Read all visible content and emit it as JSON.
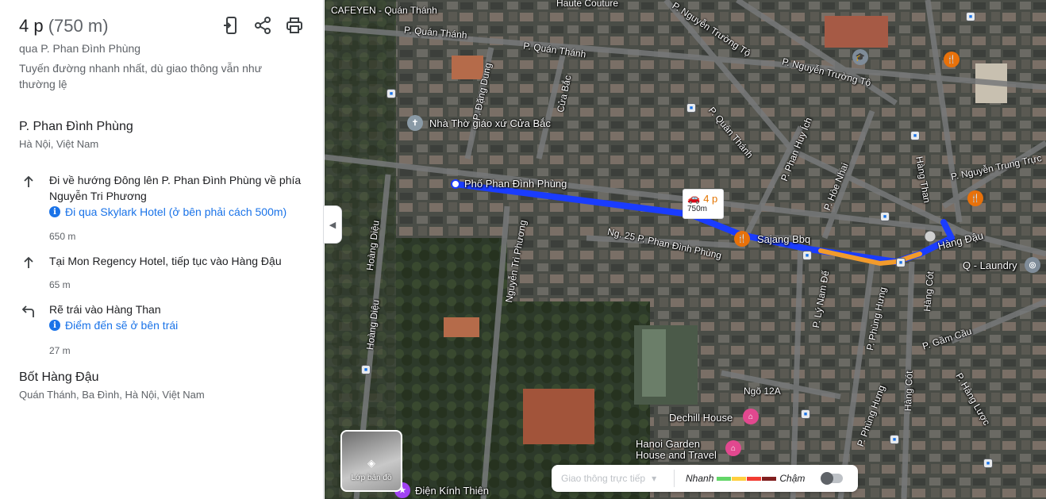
{
  "route": {
    "time": "4 p",
    "distance": "(750 m)",
    "via": "qua P. Phan Đình Phùng",
    "note": "Tuyến đường nhanh nhất, dù giao thông vẫn như thường lệ"
  },
  "toolbar_icons": [
    "send-to-phone-icon",
    "share-icon",
    "print-icon"
  ],
  "start": {
    "name": "P. Phan Đình Phùng",
    "sub": "Hà Nội, Việt Nam"
  },
  "steps": [
    {
      "icon": "arrow-up-icon",
      "text": "Đi về hướng Đông lên P. Phan Đình Phùng về phía Nguyễn Tri Phương",
      "info": "Đi qua Skylark Hotel (ở bên phải cách 500m)",
      "length": "650 m"
    },
    {
      "icon": "arrow-up-icon",
      "text": "Tại Mon Regency Hotel, tiếp tục vào Hàng Đậu",
      "info": "",
      "length": "65 m"
    },
    {
      "icon": "turn-left-icon",
      "text": "Rẽ trái vào Hàng Than",
      "info": "Điểm đến sẽ ở bên trái",
      "length": "27 m"
    }
  ],
  "end": {
    "name": "Bốt Hàng Đậu",
    "sub": "Quán Thánh, Ba Đình, Hà Nội, Việt Nam"
  },
  "map": {
    "eta_time": "4 p",
    "eta_distance": "750m",
    "layers_label": "Lớp bản đồ",
    "traffic": {
      "select": "Giao thông trực tiếp",
      "fast": "Nhanh",
      "slow": "Chậm",
      "colors": [
        "#63d668",
        "#ffcf3e",
        "#f23c32",
        "#811f1f"
      ]
    },
    "route_color": "#1a3cff",
    "slow_color": "#f29b2c",
    "labels": {
      "cafe": "CAFEYEN - Quán Thánh",
      "haute": "Haute Couture",
      "quanthanh1": "P. Quán Thánh",
      "quanthanh2": "P. Quán Thánh",
      "quanthanh3": "P. Quán Thánh",
      "dangdung": "P. Đặng Dung",
      "cuabac": "Cửa Bắc",
      "church": "Nhà Thờ giáo xứ Cửa Bắc",
      "phandinhphung": "Phố Phan Đình Phùng",
      "ntt1": "P. Nguyễn Trường Tộ",
      "ntt2": "P. Nguyễn Trường Tộ",
      "phanhuyich": "P. Phan Huy Ích",
      "honhai": "P. Hòe Nhai",
      "hangthan": "Hàng Than",
      "nguyentrungtruc": "P. Nguyễn Trung Trực",
      "hangdau": "Hàng Đậu",
      "laundry": "Q - Laundry",
      "sajang": "Sajang Bbq",
      "ng25": "Ng. 25 P. Phan Đình Phùng",
      "ntp": "Nguyễn Tri Phương",
      "hoangdieu1": "Hoàng Diệu",
      "hoangdieu2": "Hoàng Diệu",
      "lynamde": "P. Lý Nam Đế",
      "phunghung1": "P. Phùng Hưng",
      "phunghung2": "P. Phùng Hưng",
      "phunghung3": "P. Phùng Hưng",
      "hangcot1": "Hàng Cót",
      "hangcot2": "Hàng Cót",
      "gamcau": "P. Gầm Cầu",
      "hangluoc": "P. Hàng Lược",
      "ngo12a": "Ngõ 12A",
      "dechill": "Dechill House",
      "hanoigarden": "Hanoi Garden House and Travel",
      "dienkinhthien": "Điện Kính Thiên"
    }
  }
}
